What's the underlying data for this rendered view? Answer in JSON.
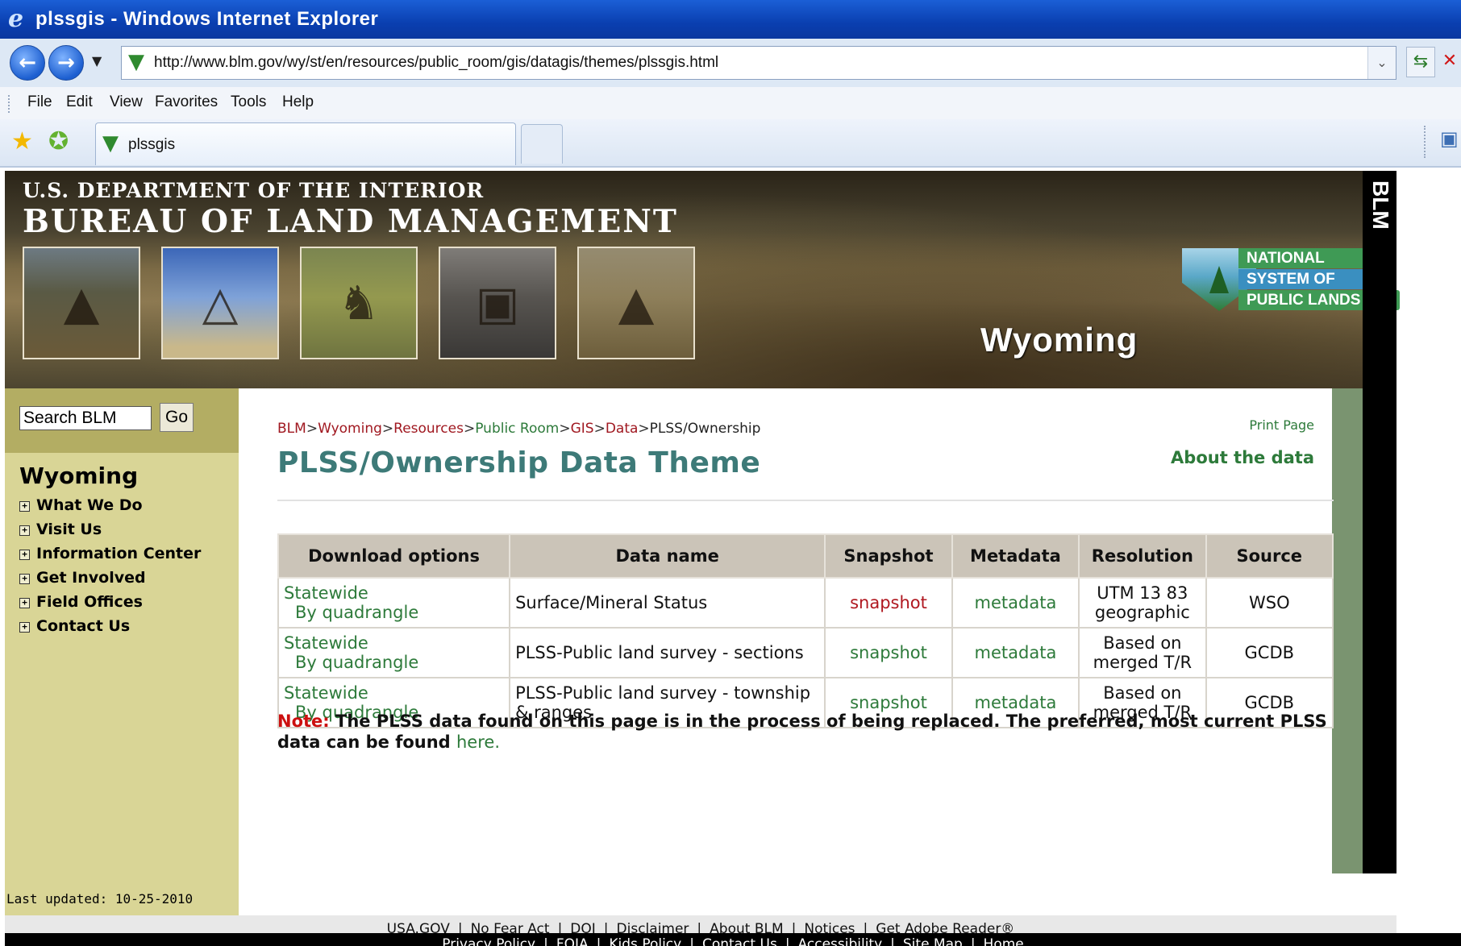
{
  "window": {
    "title": "plssgis - Windows Internet Explorer"
  },
  "address_bar": {
    "url": "http://www.blm.gov/wy/st/en/resources/public_room/gis/datagis/themes/plssgis.html"
  },
  "menu": [
    "File",
    "Edit",
    "View",
    "Favorites",
    "Tools",
    "Help"
  ],
  "tab": {
    "label": "plssgis"
  },
  "banner": {
    "dept": "U.S. DEPARTMENT OF THE INTERIOR",
    "bureau": "BUREAU OF LAND MANAGEMENT",
    "state": "Wyoming",
    "side_label": "BLM",
    "nspl_lines": [
      "NATIONAL",
      "SYSTEM OF",
      "PUBLIC LANDS"
    ]
  },
  "sidebar": {
    "search_value": "Search BLM",
    "go_label": "Go",
    "title": "Wyoming",
    "items": [
      "What We Do",
      "Visit Us",
      "Information Center",
      "Get Involved",
      "Field Offices",
      "Contact Us"
    ],
    "last_updated": "Last updated: 10-25-2010"
  },
  "breadcrumb": {
    "links": [
      "BLM",
      "Wyoming",
      "Resources",
      "Public Room",
      "GIS",
      "Data"
    ],
    "current": "PLSS/Ownership",
    "separator": ">"
  },
  "page": {
    "print_label": "Print Page",
    "about_label": "About the data",
    "title": "PLSS/Ownership Data Theme"
  },
  "table": {
    "headers": [
      "Download options",
      "Data name",
      "Snapshot",
      "Metadata",
      "Resolution",
      "Source"
    ],
    "rows": [
      {
        "statewide": "Statewide",
        "quad": "By quadrangle",
        "name": "Surface/Mineral Status",
        "snapshot": "snapshot",
        "metadata": "metadata",
        "resolution": "UTM 13 83 geographic",
        "source": "WSO"
      },
      {
        "statewide": "Statewide",
        "quad": "By quadrangle",
        "name": "PLSS-Public land survey - sections",
        "snapshot": "snapshot",
        "metadata": "metadata",
        "resolution": "Based on merged T/R",
        "source": "GCDB"
      },
      {
        "statewide": "Statewide",
        "quad": "By quadrangle",
        "name": "PLSS-Public land survey - township & ranges",
        "snapshot": "snapshot",
        "metadata": "metadata",
        "resolution": "Based on merged T/R",
        "source": "GCDB"
      }
    ]
  },
  "note": {
    "label": "Note:",
    "text": " The PLSS data found on this page is in the process of being replaced. The preferred, most current PLSS data can be found ",
    "link": "here."
  },
  "footer": {
    "row1": [
      "USA.GOV",
      "No Fear Act",
      "DOI",
      "Disclaimer",
      "About BLM",
      "Notices",
      "Get Adobe Reader®"
    ],
    "row2": [
      "Privacy Policy",
      "FOIA",
      "Kids Policy",
      "Contact Us",
      "Accessibility",
      "Site Map",
      "Home"
    ]
  },
  "colors": {
    "link_green": "#2d7a3a",
    "link_red": "#b01820",
    "sidebar": "#d9d596",
    "title_teal": "#3d7a78"
  }
}
